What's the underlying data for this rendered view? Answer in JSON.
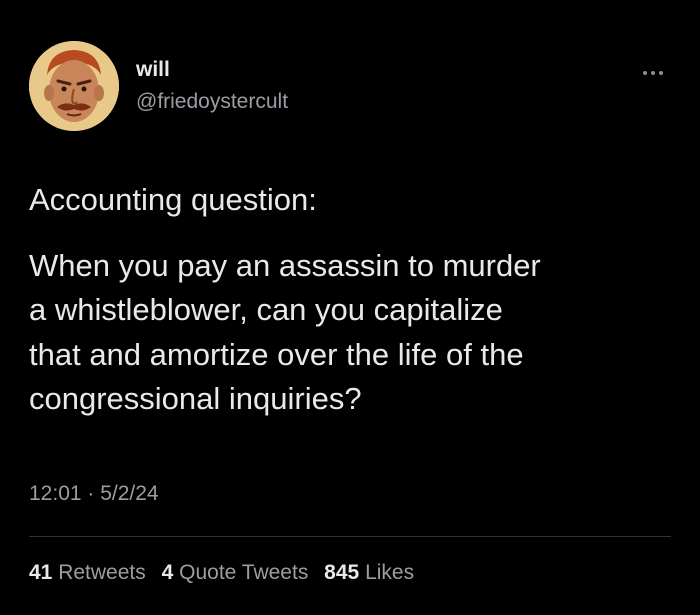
{
  "author": {
    "display_name": "will",
    "handle": "@friedoystercult"
  },
  "tweet": {
    "lines": [
      "Accounting question:",
      "When you pay an assassin to murder",
      "a whistleblower, can you capitalize",
      "that and amortize over the life of the",
      "congressional inquiries?"
    ],
    "timestamp": "12:01 · 5/2/24"
  },
  "stats": {
    "retweets": {
      "count": "41",
      "label": "Retweets"
    },
    "quote_tweets": {
      "count": "4",
      "label": "Quote Tweets"
    },
    "likes": {
      "count": "845",
      "label": "Likes"
    }
  },
  "icons": {
    "more": "more-horizontal-icon"
  },
  "colors": {
    "background": "#000000",
    "primary_text": "#e7e9ea",
    "secondary_text": "#9a9da2",
    "divider": "#2f3336"
  }
}
